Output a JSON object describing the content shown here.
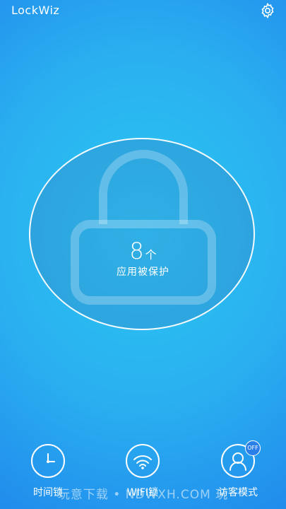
{
  "header": {
    "title": "LockWiz",
    "settings_icon": "gear-icon"
  },
  "lock_panel": {
    "count": "8",
    "unit": "个",
    "label": "应用被保护"
  },
  "features": [
    {
      "label": "时间锁",
      "icon": "clock-icon"
    },
    {
      "label": "WIFI锁",
      "icon": "wifi-icon"
    },
    {
      "label": "访客模式",
      "icon": "user-icon",
      "badge": "OFF"
    }
  ],
  "watermark": "玩意下载 • NDWXH.COM 玩"
}
